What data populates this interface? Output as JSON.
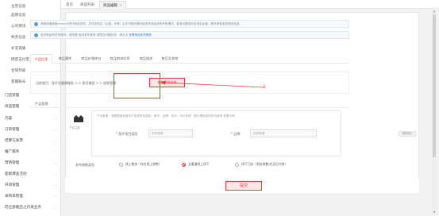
{
  "sidebar": {
    "items": [
      {
        "label": "主页信息",
        "type": "sub",
        "top": 0
      },
      {
        "label": "品牌信息",
        "type": "sub"
      },
      {
        "label": "公司资讯",
        "type": "sub"
      },
      {
        "label": "财务信息",
        "type": "sub"
      },
      {
        "label": "补充资质",
        "type": "sub"
      },
      {
        "label": "绑定支付宝",
        "type": "sub"
      },
      {
        "label": "合同列表",
        "type": "sub"
      },
      {
        "label": "客服账号",
        "type": "sub"
      },
      {
        "label": "门店管理",
        "type": "grp"
      },
      {
        "label": "商品管理",
        "type": "grp"
      },
      {
        "label": "内容",
        "type": "grp"
      },
      {
        "label": "订单管理",
        "type": "grp"
      },
      {
        "label": "结算与发票",
        "type": "grp"
      },
      {
        "label": "推广服务",
        "type": "grp"
      },
      {
        "label": "营销管理",
        "type": "grp"
      },
      {
        "label": "超级爆品活动",
        "type": "grp"
      },
      {
        "label": "开单管理",
        "type": "grp"
      },
      {
        "label": "采购单管理",
        "type": "grp"
      },
      {
        "label": "药企旗舰店之代发业务",
        "type": "grp"
      }
    ]
  },
  "topbar": {
    "crumbs": [
      "首页",
      "商品列表",
      "商品编辑"
    ]
  },
  "notices": [
    "请使用最新版chrome进行商品发布，并在发布后（火狐、IE等）由于内核问题可能发布商品或有失败情况，若有问题及时反馈至运营，联系获取更多服务信息。",
    "若对商品有任何疑问，请查看 商品发布规则 或提交问题反馈，请点击",
    "查看商品发布规则"
  ],
  "notice_link": "查看商品发布规则",
  "tabs": [
    "产品信息",
    "商品属性",
    "商品价格库存",
    "商品物流信息",
    "商品描述",
    "售后及其他"
  ],
  "category": {
    "text": "当前类目：医疗及健康服务 > > 医学美容 > > 皮肤管理",
    "edit_label": "编辑类目信息"
  },
  "annotation_number": "3.",
  "product_section": "产品信息",
  "props": {
    "note": "产品参数：请根据商品填写产品资质及相关，填写，品牌，成分，SKU名称，图片等信息的作为参考 查看示例",
    "note_link": "查看示例",
    "medical_label": "医疗项目类型",
    "medical_value": "皮肤管理",
    "brand_label": "品牌",
    "brand_value": "皮肤健康"
  },
  "image": {
    "label": "产品主图"
  },
  "side_tag": "编辑类目",
  "sell": {
    "label": "发布销售类型",
    "options": [
      "线上售卖（仅在线上销售）",
      "全渠道线上线下",
      "线下门店（到店销售/先买后付款）"
    ],
    "selected": 1
  },
  "submit_label": "提交",
  "colors": {
    "accent": "#e4393c",
    "link": "#3a7bd5"
  }
}
